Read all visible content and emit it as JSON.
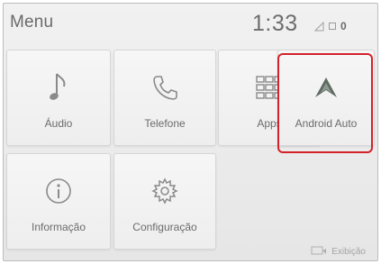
{
  "header": {
    "title": "Menu",
    "clock": "1:33",
    "message_count": "0"
  },
  "tiles": [
    {
      "label": "Áudio",
      "icon": "music-note-icon"
    },
    {
      "label": "Telefone",
      "icon": "phone-icon"
    },
    {
      "label": "Apps",
      "icon": "apps-grid-icon"
    },
    {
      "label": "Android Auto",
      "icon": "android-auto-icon"
    },
    {
      "label": "Informação",
      "icon": "info-icon"
    },
    {
      "label": "Configuração",
      "icon": "gear-icon"
    }
  ],
  "footer": {
    "display_label": "Exibição"
  },
  "colors": {
    "highlight": "#d3222a",
    "icon": "#8a8a8a",
    "android_auto_icon": "#5f6b62"
  }
}
